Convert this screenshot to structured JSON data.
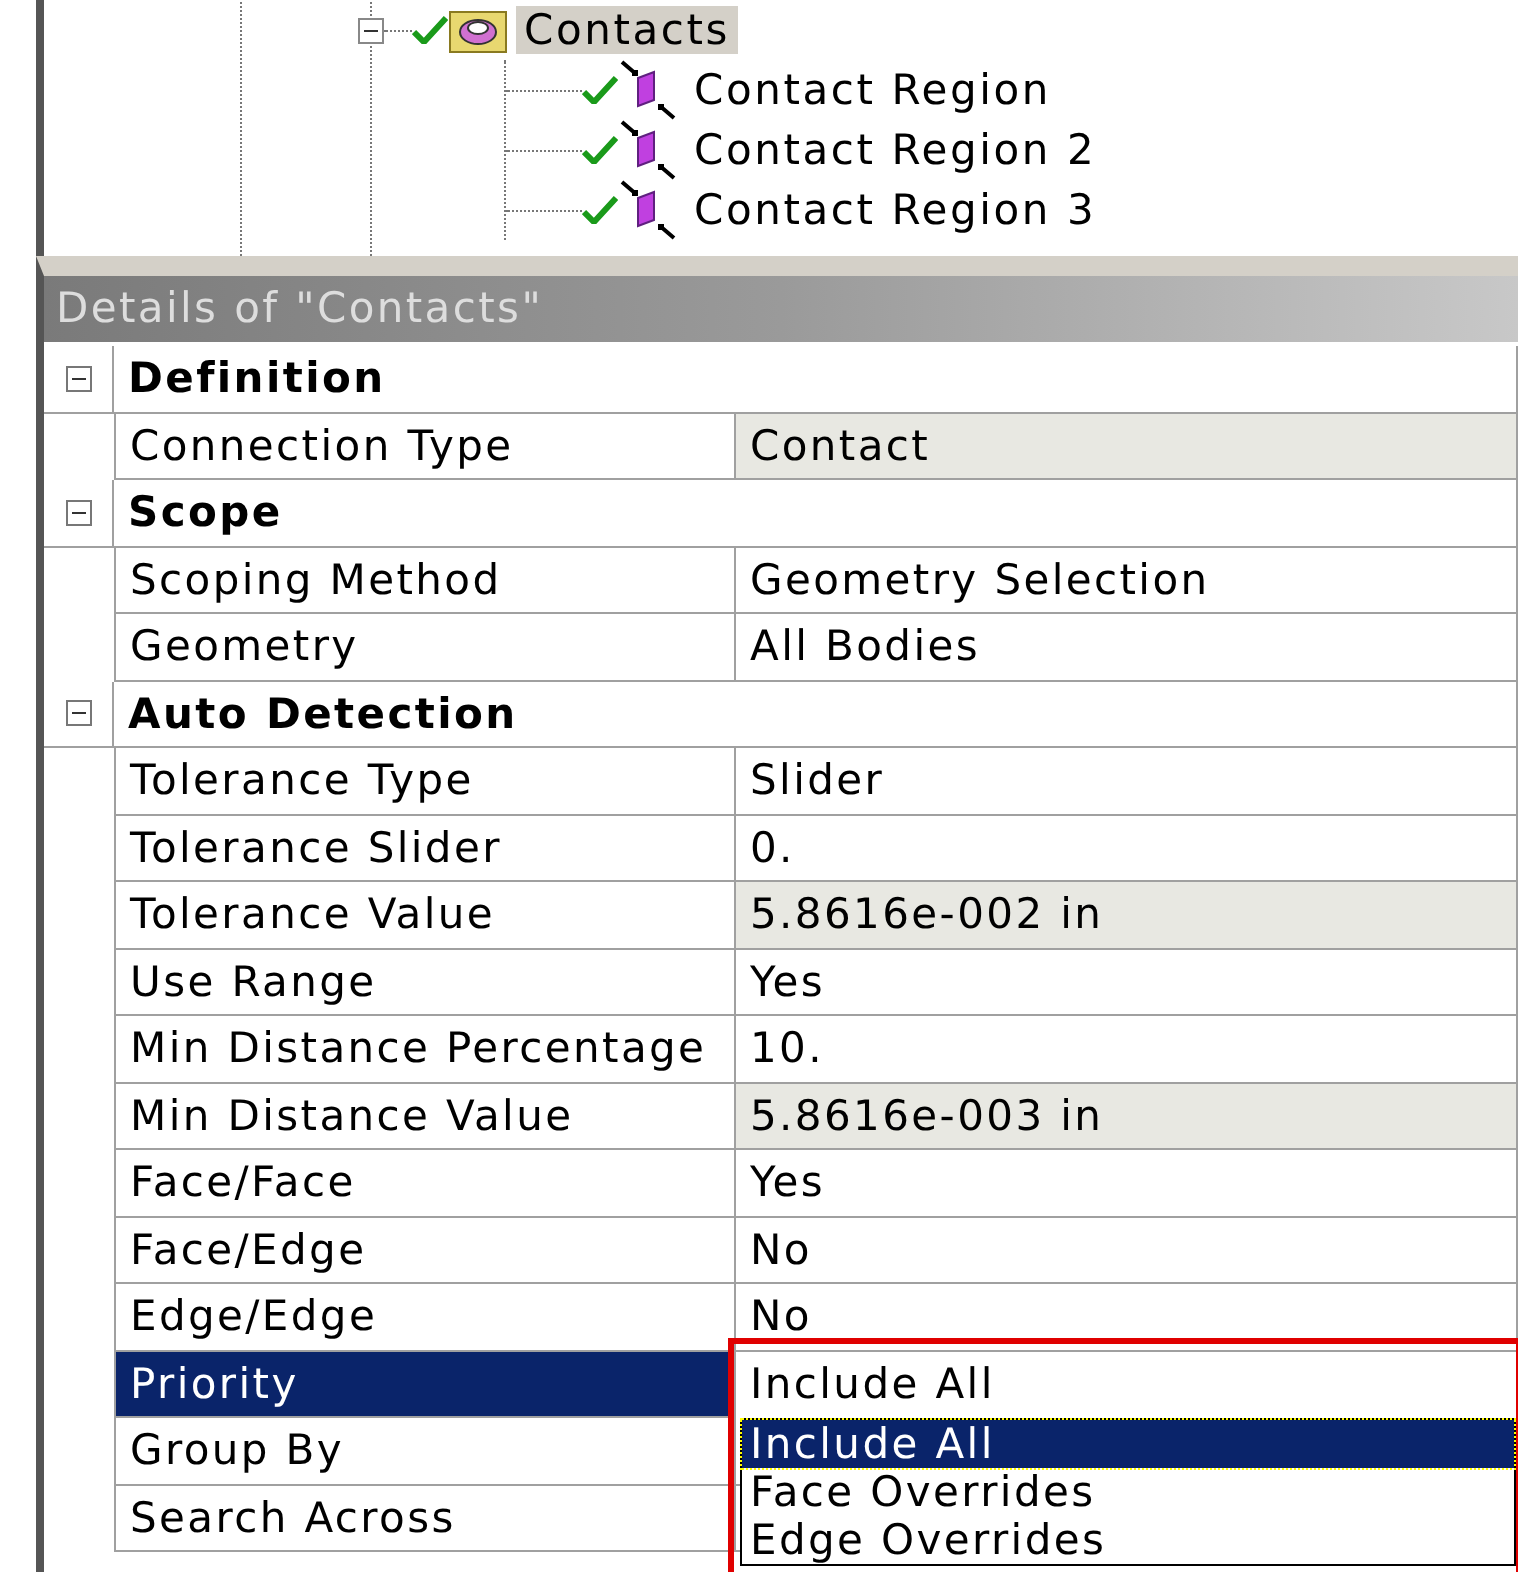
{
  "tree": {
    "items": [
      {
        "label": "Contacts",
        "expanded": true,
        "selected": true,
        "children": [
          {
            "label": "Contact Region",
            "selected": false
          },
          {
            "label": "Contact Region 2",
            "selected": false
          },
          {
            "label": "Contact Region 3",
            "selected": false
          }
        ]
      }
    ]
  },
  "details": {
    "title": "Details of \"Contacts\"",
    "groups": [
      {
        "label": "Definition",
        "expanded": true,
        "rows": [
          {
            "name": "Connection Type",
            "value": "Contact",
            "readonly": true,
            "selected": false
          }
        ]
      },
      {
        "label": "Scope",
        "expanded": true,
        "rows": [
          {
            "name": "Scoping Method",
            "value": "Geometry Selection",
            "readonly": false,
            "selected": false
          },
          {
            "name": "Geometry",
            "value": "All Bodies",
            "readonly": false,
            "selected": false
          }
        ]
      },
      {
        "label": "Auto Detection",
        "expanded": true,
        "rows": [
          {
            "name": "Tolerance Type",
            "value": "Slider",
            "readonly": false,
            "selected": false
          },
          {
            "name": "Tolerance Slider",
            "value": "0.",
            "readonly": false,
            "selected": false
          },
          {
            "name": "Tolerance Value",
            "value": "5.8616e-002 in",
            "readonly": true,
            "selected": false
          },
          {
            "name": "Use Range",
            "value": "Yes",
            "readonly": false,
            "selected": false
          },
          {
            "name": "Min Distance Percentage",
            "value": "10.",
            "readonly": false,
            "selected": false
          },
          {
            "name": "Min Distance Value",
            "value": "5.8616e-003 in",
            "readonly": true,
            "selected": false
          },
          {
            "name": "Face/Face",
            "value": "Yes",
            "readonly": false,
            "selected": false
          },
          {
            "name": "Face/Edge",
            "value": "No",
            "readonly": false,
            "selected": false
          },
          {
            "name": "Edge/Edge",
            "value": "No",
            "readonly": false,
            "selected": false
          },
          {
            "name": "Priority",
            "kind": "dropdown",
            "readonly": false,
            "selected": true,
            "dropdown": {
              "value": "Include All",
              "open": true,
              "highlighted": true,
              "options": [
                {
                  "label": "Include All",
                  "selected": true
                },
                {
                  "label": "Face Overrides",
                  "selected": false
                },
                {
                  "label": "Edge Overrides",
                  "selected": false
                }
              ]
            }
          },
          {
            "name": "Group By",
            "readonly": false,
            "selected": false
          },
          {
            "name": "Search Across",
            "readonly": false,
            "selected": false
          }
        ]
      }
    ]
  }
}
